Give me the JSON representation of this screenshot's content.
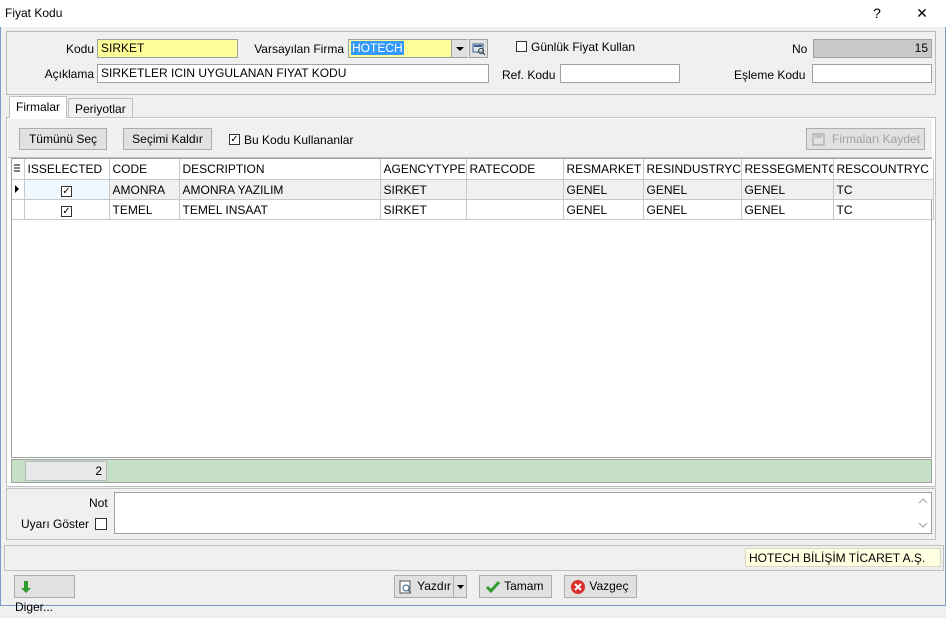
{
  "window": {
    "title": "Fiyat Kodu",
    "help_glyph": "?",
    "close_glyph": "✕"
  },
  "header": {
    "kodu_label": "Kodu",
    "kodu_value": "SIRKET",
    "varsayilan_label": "Varsayılan Firma",
    "varsayilan_value": "HOTECH",
    "gunluk_label": "Günlük Fiyat Kullan",
    "gunluk_checked": false,
    "no_label": "No",
    "no_value": "15",
    "aciklama_label": "Açıklama",
    "aciklama_value": "SIRKETLER ICIN UYGULANAN FIYAT KODU",
    "ref_label": "Ref. Kodu",
    "ref_value": "",
    "esleme_label": "Eşleme Kodu",
    "esleme_value": ""
  },
  "tabs": [
    {
      "label": "Firmalar",
      "active": true
    },
    {
      "label": "Periyotlar",
      "active": false
    }
  ],
  "toolbar": {
    "select_all": "Tümünü Seç",
    "deselect": "Seçimi Kaldır",
    "users_label": "Bu Kodu Kullananlar",
    "users_checked": true,
    "save_firms": "Firmaları Kaydet"
  },
  "grid": {
    "columns": [
      "ISSELECTED",
      "CODE",
      "DESCRIPTION",
      "AGENCYTYPE",
      "RATECODE",
      "RESMARKET",
      "RESINDUSTRYC",
      "RESSEGMENTC",
      "RESCOUNTRYC"
    ],
    "rows": [
      {
        "isselected": true,
        "code": "AMONRA",
        "description": "AMONRA YAZILIM",
        "agencytype": "SIRKET",
        "ratecode": "",
        "resmarket": "GENEL",
        "resindustry": "GENEL",
        "ressegment": "GENEL",
        "rescountry": "TC"
      },
      {
        "isselected": true,
        "code": "TEMEL",
        "description": "TEMEL INSAAT",
        "agencytype": "SIRKET",
        "ratecode": "",
        "resmarket": "GENEL",
        "resindustry": "GENEL",
        "ressegment": "GENEL",
        "rescountry": "TC"
      }
    ],
    "footer_count": "2"
  },
  "notes": {
    "not_label": "Not",
    "uyari_label": "Uyarı Göster",
    "uyari_checked": false,
    "not_value": ""
  },
  "status": {
    "company": "HOTECH BİLİŞİM TİCARET A.Ş."
  },
  "buttons": {
    "diger": "Diger...",
    "yazdir": "Yazdır",
    "tamam": "Tamam",
    "vazgec": "Vazgeç"
  },
  "colors": {
    "required_field": "#ffff99",
    "grid_footer": "#c6e0c6",
    "selection": "#3399ff"
  }
}
